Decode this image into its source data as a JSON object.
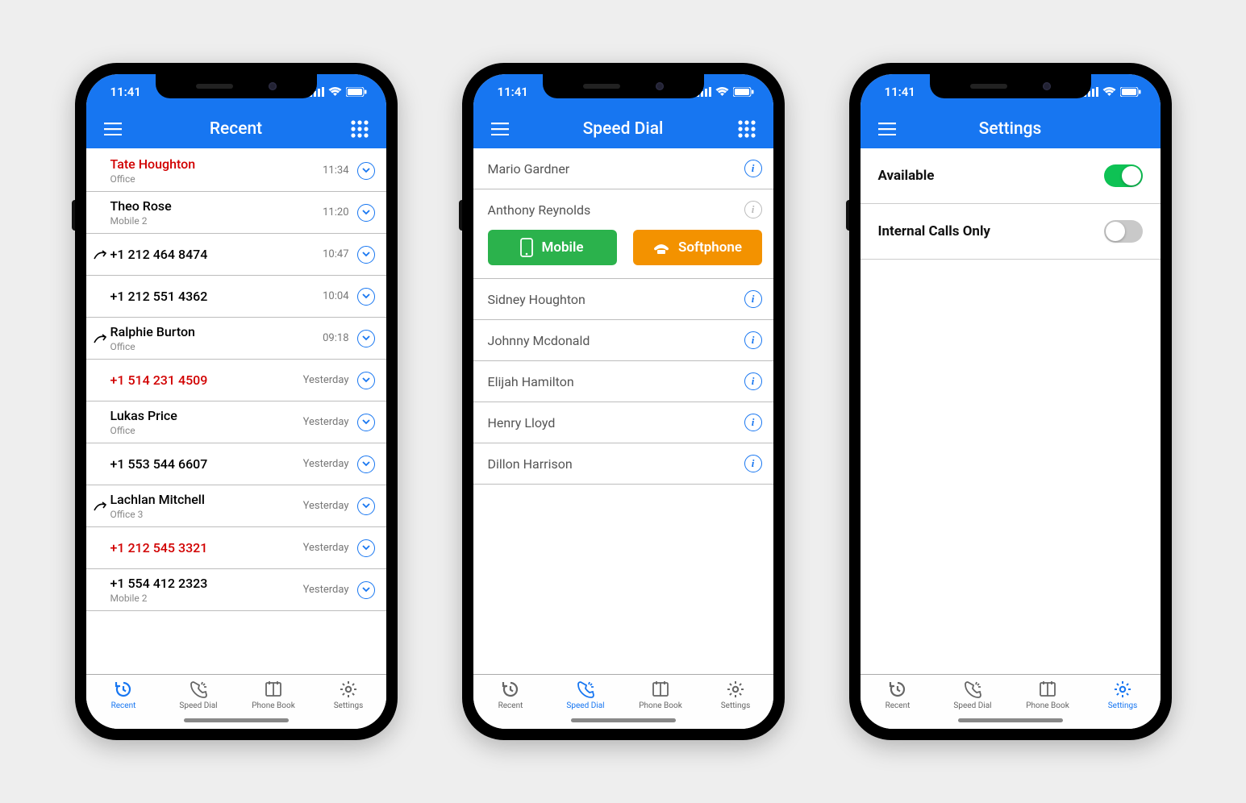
{
  "status": {
    "time": "11:41"
  },
  "tabs": {
    "recent": "Recent",
    "speed_dial": "Speed Dial",
    "phone_book": "Phone Book",
    "settings": "Settings"
  },
  "phone1": {
    "title": "Recent",
    "calls": [
      {
        "name": "Tate Houghton",
        "sub": "Office",
        "time": "11:34",
        "missed": true,
        "out": false
      },
      {
        "name": "Theo Rose",
        "sub": "Mobile 2",
        "time": "11:20",
        "missed": false,
        "out": false
      },
      {
        "name": "+1 212 464 8474",
        "sub": "",
        "time": "10:47",
        "missed": false,
        "out": true
      },
      {
        "name": "+1 212 551 4362",
        "sub": "",
        "time": "10:04",
        "missed": false,
        "out": false
      },
      {
        "name": "Ralphie Burton",
        "sub": "Office",
        "time": "09:18",
        "missed": false,
        "out": true
      },
      {
        "name": "+1 514 231 4509",
        "sub": "",
        "time": "Yesterday",
        "missed": true,
        "out": false
      },
      {
        "name": "Lukas Price",
        "sub": "Office",
        "time": "Yesterday",
        "missed": false,
        "out": false
      },
      {
        "name": "+1 553 544 6607",
        "sub": "",
        "time": "Yesterday",
        "missed": false,
        "out": false
      },
      {
        "name": "Lachlan Mitchell",
        "sub": "Office 3",
        "time": "Yesterday",
        "missed": false,
        "out": true
      },
      {
        "name": "+1 212 545 3321",
        "sub": "",
        "time": "Yesterday",
        "missed": true,
        "out": false
      },
      {
        "name": "+1 554 412 2323",
        "sub": "Mobile 2",
        "time": "Yesterday",
        "missed": false,
        "out": false
      }
    ]
  },
  "phone2": {
    "title": "Speed Dial",
    "contacts": [
      {
        "name": "Mario Gardner",
        "expanded": false,
        "muted": false
      },
      {
        "name": "Anthony Reynolds",
        "expanded": true,
        "muted": true
      },
      {
        "name": "Sidney Houghton",
        "expanded": false,
        "muted": false
      },
      {
        "name": "Johnny Mcdonald",
        "expanded": false,
        "muted": false
      },
      {
        "name": "Elijah Hamilton",
        "expanded": false,
        "muted": false
      },
      {
        "name": "Henry Lloyd",
        "expanded": false,
        "muted": false
      },
      {
        "name": "Dillon Harrison",
        "expanded": false,
        "muted": false
      }
    ],
    "mobile_btn": "Mobile",
    "softphone_btn": "Softphone"
  },
  "phone3": {
    "title": "Settings",
    "rows": [
      {
        "label": "Available",
        "on": true
      },
      {
        "label": "Internal Calls Only",
        "on": false
      }
    ]
  }
}
